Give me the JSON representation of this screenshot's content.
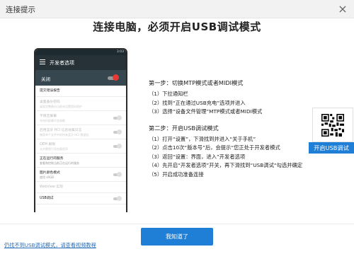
{
  "window": {
    "title": "连接提示",
    "close_glyph": "×"
  },
  "heading": "连接电脑，必须开启USB调试模式",
  "phone": {
    "status_time": "3:03",
    "app_title": "开发者选项",
    "master_label": "关闭",
    "rows": [
      {
        "title": "提交错误报告",
        "sub": "",
        "dim": false,
        "toggle": false
      },
      {
        "title": "桌面备份密码",
        "sub": "桌面完整备份当前未设置密码保护",
        "dim": true,
        "toggle": false
      },
      {
        "title": "不锁定屏幕",
        "sub": "充电时屏幕不会休眠",
        "dim": true,
        "toggle": true
      },
      {
        "title": "启用蓝牙 HCI 信息收集日志",
        "sub": "捕获单个文件中的所有蓝牙 HCI 数据包",
        "dim": true,
        "toggle": true
      },
      {
        "title": "OEM 解锁",
        "sub": "允许解锁引导加载程序",
        "dim": true,
        "toggle": true
      },
      {
        "title": "正在运行的服务",
        "sub": "查看和控制当前正在运行的服务",
        "dim": false,
        "toggle": false
      },
      {
        "title": "图片颜色模式",
        "sub": "使用 sRGB",
        "dim": false,
        "toggle": true
      },
      {
        "title": "WebView 实现",
        "sub": "",
        "dim": true,
        "toggle": false
      },
      {
        "title": "USB调试",
        "sub": "",
        "dim": false,
        "toggle": true
      }
    ]
  },
  "steps": {
    "step1_title": "第一步：切换MTP模式或者MIDI模式",
    "step1": [
      "（1）下拉通知栏",
      "（2）找到“正在通过USB充电”选项并进入",
      "（3）选择“设备文件管理”MTP模式或者MIDI模式"
    ],
    "step2_title": "第二步：开启USB调试模式",
    "step2": [
      "（1）打开“设置”，下滑找到并进入“关于手机”",
      "（2）点击10次“版本号”后，会提示“您正处于开发者模式",
      "（3）返回“设置：界面，进入”开发者选项",
      "（4）先开启“开发者选项”开关，再下滑找到“USB调试“勾选并确定",
      "（5）开启成功准备连接"
    ]
  },
  "qr": {
    "icon": "qr-code-icon",
    "button_label": "开启USB调试"
  },
  "ok_button": "我知道了",
  "bottom_link": "仍找不到USB调试模式，请查看视频教程",
  "colors": {
    "accent": "#1f7ed6",
    "phone_bar": "#263238",
    "phone_master": "#37474f",
    "toggle_red": "#e53935"
  }
}
